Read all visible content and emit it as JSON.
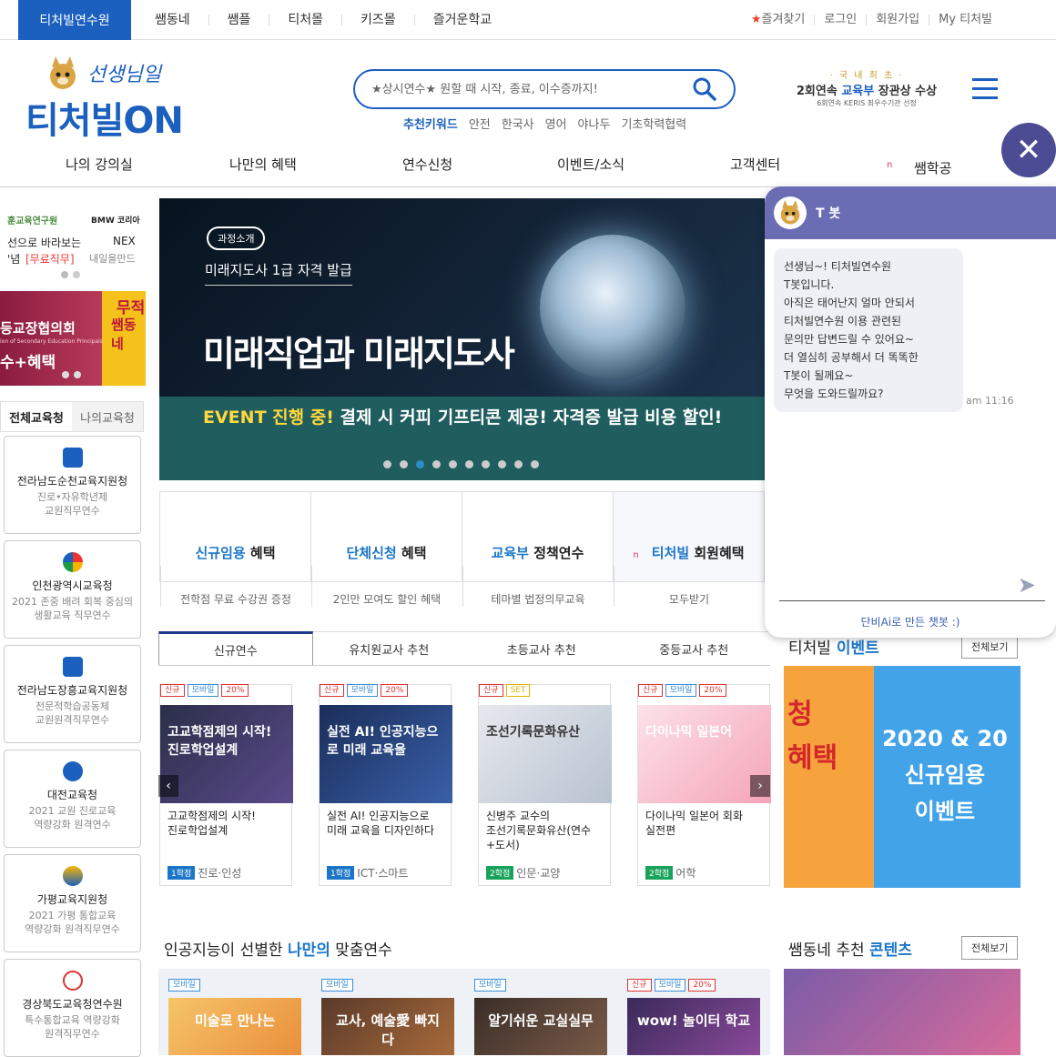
{
  "topbar": {
    "brand": "티처빌연수원",
    "nav": [
      "쌤동네",
      "쌤플",
      "티처몰",
      "키즈몰",
      "즐거운학교"
    ],
    "util": [
      "즐겨찾기",
      "로그인",
      "회원가입",
      "My 티처빌"
    ]
  },
  "header": {
    "logo_sub": "선생님일",
    "logo_main": "티처빌ON",
    "search_placeholder": "★상시연수★ 원할 때 시작, 종료, 이수증까지!",
    "keyword_label": "추천키워드",
    "keywords": [
      "안전",
      "한국사",
      "영어",
      "야나두",
      "기초학력협력"
    ],
    "award_line1": "· 국 내 최 초 ·",
    "award_line2_pre": "2회연속 ",
    "award_line2_hl": "교육부",
    "award_line2_post": " 장관상 수상",
    "award_line3": "6회연속 KERIS 최우수기관 선정"
  },
  "mainnav": [
    "나의 강의실",
    "나만의 혜택",
    "연수신청",
    "이벤트/소식",
    "고객센터",
    "쌤학공"
  ],
  "mainnav_new": "n",
  "sidebar": {
    "banner1_left_logo": "훈교육연구원",
    "banner1_right_logo": "BMW 코리아",
    "banner1_left_text": "선으로 바라보는",
    "banner1_left_text2": "'념",
    "banner1_left_free": "[무료직무]",
    "banner1_right_text": "NEX",
    "banner1_right_text2": "내일을만드",
    "banner2_text": "등교장협의회",
    "banner2_sub": "ion of Secondary Education Principals",
    "banner2_text2": "수+혜택",
    "banner2_right": "무적",
    "banner2_right2": "쌤동네",
    "tabs": [
      "전체교육청",
      "나의교육청"
    ],
    "offices": [
      {
        "name": "전라남도순천교육지원청",
        "desc": "진로•자유학년제\n교원직무연수"
      },
      {
        "name": "인천광역시교육청",
        "desc": "2021 존중 배려 회복 중심의\n생활교육 직무연수"
      },
      {
        "name": "전라남도장흥교육지원청",
        "desc": "전문적학습공동체\n교원원격직무연수"
      },
      {
        "name": "대전교육청",
        "desc": "2021 교원 진로교육\n역량강화 원격연수"
      },
      {
        "name": "가평교육지원청",
        "desc": "2021 가평 통합교육\n역량강화 원격직무연수"
      },
      {
        "name": "경상북도교육청연수원",
        "desc": "특수통합교육 역량강화\n원격직무연수"
      }
    ]
  },
  "hero": {
    "pill": "과정소개",
    "sub": "미래지도사 1급 자격 발급",
    "title": "미래직업과 미래지도사",
    "event_hl": "EVENT 진행 중!",
    "event_text": " 결제 시 커피 기프티콘 제공! 자격증 발급 비용 할인!",
    "active_slide": 2,
    "slide_count": 10
  },
  "benefits": [
    {
      "hl": "신규임용",
      "rest": " 혜택",
      "sub": "전학점 무료 수강권 증정"
    },
    {
      "hl": "단체신청",
      "rest": " 혜택",
      "sub": "2인만 모여도 할인 혜택"
    },
    {
      "hl": "교육부",
      "rest": " 정책연수",
      "sub": "테마별 법정의무교육"
    },
    {
      "hl": "티처빌",
      "rest": " 회원혜택",
      "sub": "모두받기"
    }
  ],
  "course_tabs": [
    "신규연수",
    "유치원교사 추천",
    "초등교사 추천",
    "중등교사 추천"
  ],
  "courses": [
    {
      "tags": [
        "신규",
        "모바일",
        "20%"
      ],
      "img_text": "고교학점제의 시작! 진로학업설계",
      "name": "고교학점제의 시작!\n진로학업설계",
      "credit": "1학점",
      "cat": "진로·인성",
      "credit_color": "#1b76c8"
    },
    {
      "tags": [
        "신규",
        "모바일",
        "20%"
      ],
      "img_text": "실전 AI! 인공지능으로 미래 교육을",
      "name": "실전 AI! 인공지능으로\n미래 교육을 디자인하다",
      "credit": "1학점",
      "cat": "ICT·스마트",
      "credit_color": "#1b76c8"
    },
    {
      "tags": [
        "신규",
        "SET"
      ],
      "img_text": "조선기록문화유산",
      "name": "신병주 교수의\n조선기록문화유산(연수\n+도서)",
      "credit": "2학점",
      "cat": "인문·교양",
      "credit_color": "#19a35a"
    },
    {
      "tags": [
        "신규",
        "모바일",
        "20%"
      ],
      "img_text": "다이나믹 일본어",
      "name": "다이나믹 일본어 회화\n실전편",
      "credit": "2학점",
      "cat": "어학",
      "credit_color": "#19a35a"
    }
  ],
  "event": {
    "title_pre": "티처빌",
    "title_hl": " 이벤트",
    "more": "전체보기",
    "img_left": "청\n혜택",
    "img_right": "2020 & 20\n신규임용\n이벤트"
  },
  "ai_section": {
    "title_pre": "인공지능이 선별한 ",
    "title_hl": "나만의",
    "title_post": " 맞춤연수"
  },
  "sam_section": {
    "title_pre": "쌤동네 추천 ",
    "title_hl": "콘텐츠",
    "more": "전체보기"
  },
  "mini_cards": [
    {
      "tags": [
        "모바일"
      ],
      "text": "미술로 만나는"
    },
    {
      "tags": [
        "모바일"
      ],
      "text": "교사, 예술愛 빠지다"
    },
    {
      "tags": [
        "모바일"
      ],
      "text": "알기쉬운 교실실무"
    },
    {
      "tags": [
        "신규",
        "모바일",
        "20%"
      ],
      "text": "wow! 놀이터 학교"
    }
  ],
  "chatbot": {
    "name": "T 봇",
    "message": "선생님~! 티처빌연수원\nT봇입니다.\n아직은 태어난지 얼마 안되서\n티처빌연수원 이용 관련된\n문의만 답변드릴 수 있어요~\n더 열심히 공부해서 더 똑똑한\nT봇이 될께요~\n무엇을 도와드릴까요?",
    "time": "am 11:16",
    "input_value": "",
    "footer": "단비Ai로 만든 챗봇 :)"
  },
  "colors": {
    "brand": "#1b5fbf",
    "accent": "#1b76c8",
    "chat_header": "#6a6cb4",
    "close_button": "#4b4c94"
  }
}
